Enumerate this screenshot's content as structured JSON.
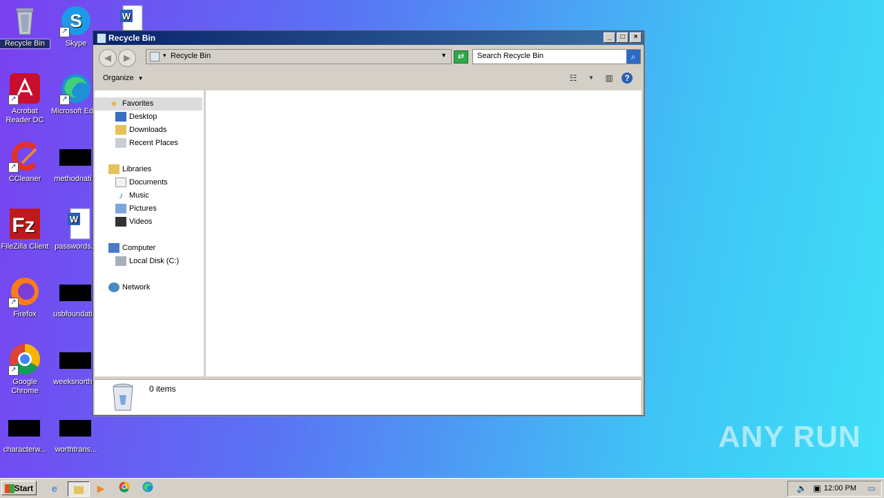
{
  "desktop": {
    "icons": [
      {
        "label": "Recycle Bin",
        "icon": "recycle-bin-icon"
      },
      {
        "label": "Skype",
        "icon": "skype-icon"
      },
      {
        "label": "",
        "icon": "word-document-icon"
      },
      {
        "label": "Acrobat Reader DC",
        "icon": "acrobat-icon"
      },
      {
        "label": "Microsoft Edge",
        "icon": "edge-icon"
      },
      {
        "label": "CCleaner",
        "icon": "ccleaner-icon"
      },
      {
        "label": "methodnati...",
        "icon": "black-file-icon"
      },
      {
        "label": "FileZilla Client",
        "icon": "filezilla-icon"
      },
      {
        "label": "passwords...",
        "icon": "word-document-icon"
      },
      {
        "label": "Firefox",
        "icon": "firefox-icon"
      },
      {
        "label": "usbfoundati...",
        "icon": "black-file-icon"
      },
      {
        "label": "Google Chrome",
        "icon": "chrome-icon"
      },
      {
        "label": "weeksnorth...",
        "icon": "black-file-icon"
      },
      {
        "label": "characterw...",
        "icon": "black-file-icon"
      },
      {
        "label": "worthtrans...",
        "icon": "black-file-icon"
      }
    ]
  },
  "window": {
    "title": "Recycle Bin",
    "address": "Recycle Bin",
    "search_placeholder": "Search Recycle Bin",
    "organize_label": "Organize",
    "nav": {
      "favorites": "Favorites",
      "desktop": "Desktop",
      "downloads": "Downloads",
      "recent": "Recent Places",
      "libraries": "Libraries",
      "documents": "Documents",
      "music": "Music",
      "pictures": "Pictures",
      "videos": "Videos",
      "computer": "Computer",
      "local_disk": "Local Disk (C:)",
      "network": "Network"
    },
    "status_count": "0 items"
  },
  "taskbar": {
    "start_label": "Start",
    "clock": "12:00 PM"
  },
  "watermark": "ANY RUN",
  "colors": {
    "titlebar": "#0a246a",
    "desktop_left": "#7a40f0",
    "desktop_right": "#40e0f8"
  }
}
